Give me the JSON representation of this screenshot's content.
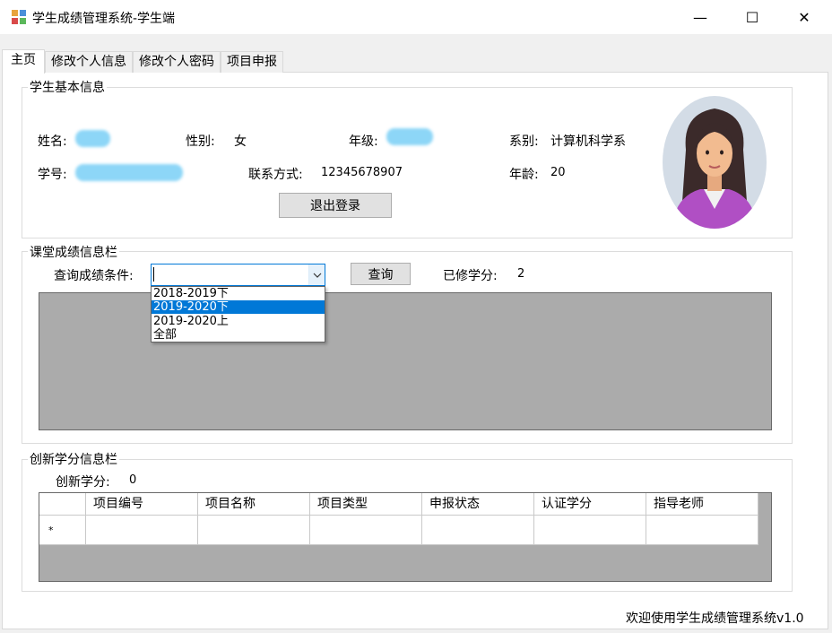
{
  "window": {
    "title": "学生成绩管理系统-学生端",
    "min_glyph": "—",
    "max_glyph": "☐",
    "close_glyph": "✕"
  },
  "tabs": [
    {
      "label": "主页",
      "active": true
    },
    {
      "label": "修改个人信息"
    },
    {
      "label": "修改个人密码"
    },
    {
      "label": "项目申报"
    }
  ],
  "basic_info": {
    "legend": "学生基本信息",
    "name_label": "姓名:",
    "gender_label": "性别:",
    "gender_value": "女",
    "grade_label": "年级:",
    "dept_label": "系别:",
    "dept_value": "计算机科学系",
    "id_label": "学号:",
    "contact_label": "联系方式:",
    "contact_value": "12345678907",
    "age_label": "年龄:",
    "age_value": "20",
    "logout_button": "退出登录"
  },
  "grades": {
    "legend": "课堂成绩信息栏",
    "query_label": "查询成绩条件:",
    "query_button": "查询",
    "credits_label": "已修学分:",
    "credits_value": "2",
    "options": [
      "2018-2019下",
      "2019-2020下",
      "2019-2020上",
      "全部"
    ],
    "selected_index": 1
  },
  "innovation": {
    "legend": "创新学分信息栏",
    "credits_label": "创新学分:",
    "credits_value": "0",
    "columns": [
      "项目编号",
      "项目名称",
      "项目类型",
      "申报状态",
      "认证学分",
      "指导老师"
    ],
    "new_row_marker": "*"
  },
  "status_text": "欢迎使用学生成绩管理系统v1.0"
}
